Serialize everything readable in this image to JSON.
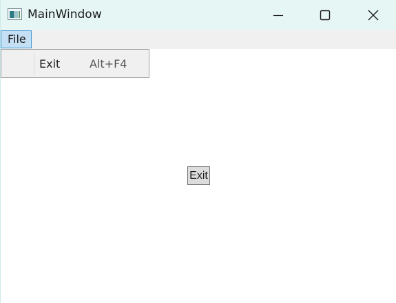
{
  "window": {
    "title": "MainWindow",
    "accent_color": "#e6f6f5",
    "controls": {
      "minimize_icon": "minimize-icon",
      "maximize_icon": "maximize-icon",
      "close_icon": "close-icon"
    }
  },
  "menubar": {
    "items": [
      {
        "label": "File",
        "icon": ""
      }
    ]
  },
  "file_menu": {
    "items": [
      {
        "label": "Exit",
        "shortcut": "Alt+F4"
      }
    ]
  },
  "main": {
    "exit_button_label": "Exit"
  }
}
